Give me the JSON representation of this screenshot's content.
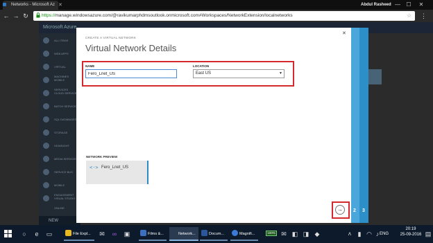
{
  "browser": {
    "tab_title": "Networks - Microsoft Az",
    "user_name": "Abdul Rasheed",
    "url_scheme": "https://",
    "url_rest": "manage.windowsazure.com/@ravikumarphdmsoutlook.onmicrosoft.com#Workspaces/NetworkExtension/localnetworks",
    "back_icon": "←",
    "forward_icon": "→",
    "reload_icon": "↻",
    "star_icon": "☆",
    "menu_icon": "⋮",
    "minimize": "—",
    "maximize": "☐",
    "close": "✕"
  },
  "portal": {
    "logo_text": "Microsoft Azure",
    "new_label": "NEW",
    "nav_items": [
      "ALL ITEMS",
      "WEB APPS",
      "VIRTUAL MACHINES",
      "MOBILE SERVICES",
      "CLOUD SERVICES",
      "BATCH SERVICES",
      "SQL DATABASES",
      "STORAGE",
      "HDINSIGHT",
      "MEDIA SERVICES",
      "SERVICE BUS",
      "MOBILE ENGAGEMENT",
      "VISUAL STUDIO ONLINE"
    ]
  },
  "dialog": {
    "subtitle": "CREATE A VIRTUAL NETWORK",
    "title": "Virtual Network Details",
    "close_icon": "✕",
    "name_label": "NAME",
    "name_value": "Fero_Lnet_US",
    "location_label": "LOCATION",
    "location_value": "East US",
    "preview_label": "NETWORK PREVIEW",
    "preview_icon": "<·>",
    "preview_name": "Fero_Lnet_US",
    "next_icon": "→",
    "steps": [
      "2",
      "3"
    ]
  },
  "taskbar": {
    "apps": [
      {
        "label": "File Expl...",
        "color": "#e8b923"
      },
      {
        "label": "Films &...",
        "color": "#3c6fbe"
      },
      {
        "label": "Network...",
        "color": "#4285f4"
      },
      {
        "label": "Docum...",
        "color": "#2b579a"
      },
      {
        "label": "Magnifi...",
        "color": "#3a7bd5"
      }
    ],
    "battery": "100%",
    "lang": "ENG",
    "time": "20:19",
    "date": "25-09-2016"
  },
  "colors": {
    "accent": "#2d8fc8",
    "highlight": "#d4282c"
  }
}
